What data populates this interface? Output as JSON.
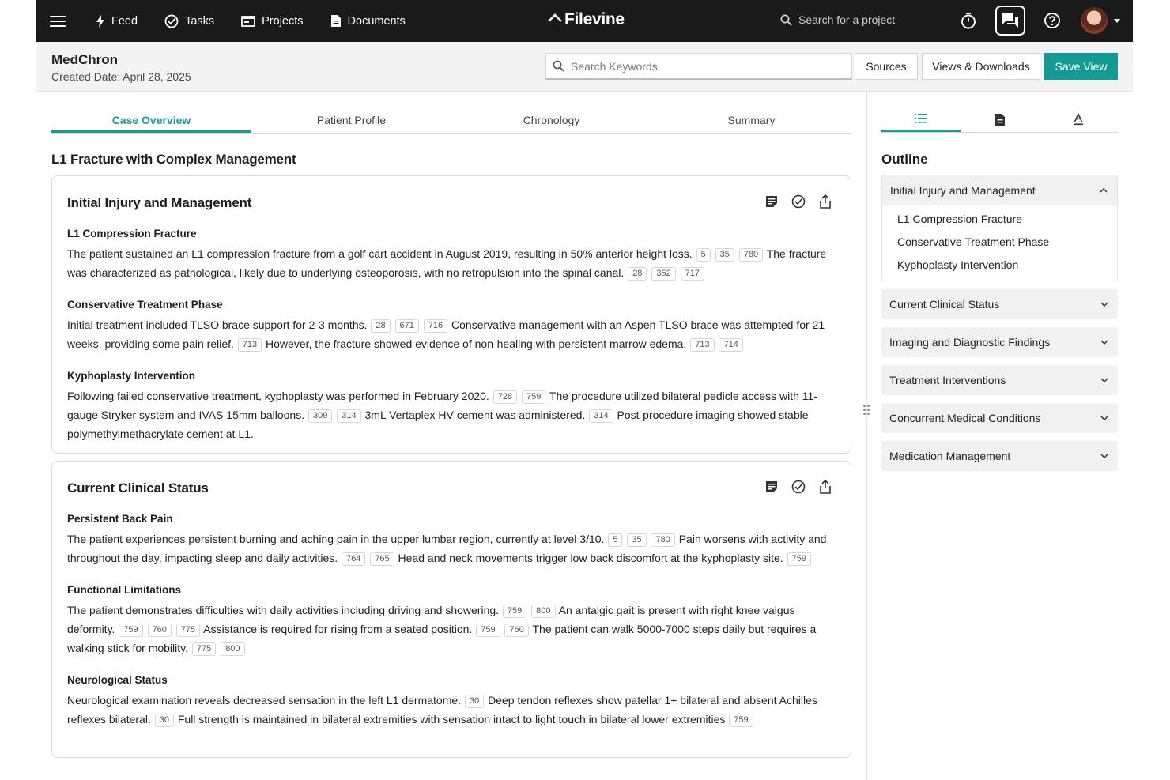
{
  "nav": {
    "items": [
      {
        "label": "Feed",
        "icon": "bolt-icon"
      },
      {
        "label": "Tasks",
        "icon": "check-circle-icon"
      },
      {
        "label": "Projects",
        "icon": "projects-icon"
      },
      {
        "label": "Documents",
        "icon": "document-icon"
      }
    ],
    "brand": "Filevine",
    "search_placeholder": "Search for a project"
  },
  "header": {
    "project_name": "MedChron",
    "created_date": "Created Date: April 28, 2025",
    "search_placeholder": "Search Keywords",
    "sources_label": "Sources",
    "views_label": "Views & Downloads",
    "save_label": "Save View"
  },
  "tabs": [
    "Case Overview",
    "Patient Profile",
    "Chronology",
    "Summary"
  ],
  "main_title": "L1 Fracture with Complex Management",
  "cards": [
    {
      "title": "Initial Injury and Management",
      "sections": [
        {
          "title": "L1 Compression Fracture",
          "parts": [
            {
              "t": "The patient sustained an L1 compression fracture from a golf cart accident in August 2019, resulting in 50% anterior height loss. "
            },
            {
              "r": [
                "5",
                "35",
                "780"
              ]
            },
            {
              "t": " The fracture was characterized as pathological, likely due to underlying osteoporosis, with no retropulsion into the spinal canal. "
            },
            {
              "r": [
                "28",
                "352",
                "717"
              ]
            }
          ]
        },
        {
          "title": "Conservative Treatment Phase",
          "parts": [
            {
              "t": "Initial treatment included TLSO brace support for 2-3 months. "
            },
            {
              "r": [
                "28",
                "671",
                "716"
              ]
            },
            {
              "t": " Conservative management with an Aspen TLSO brace was attempted for 21 weeks, providing some pain relief. "
            },
            {
              "r": [
                "713"
              ]
            },
            {
              "t": " However, the fracture showed evidence of non-healing with persistent marrow edema. "
            },
            {
              "r": [
                "713",
                "714"
              ]
            }
          ]
        },
        {
          "title": "Kyphoplasty Intervention",
          "parts": [
            {
              "t": "Following failed conservative treatment, kyphoplasty was performed in February 2020. "
            },
            {
              "r": [
                "728",
                "759"
              ]
            },
            {
              "t": " The procedure utilized bilateral pedicle access with 11-gauge Stryker system and IVAS 15mm balloons. "
            },
            {
              "r": [
                "309",
                "314"
              ]
            },
            {
              "t": " 3mL Vertaplex HV cement was administered. "
            },
            {
              "r": [
                "314"
              ]
            },
            {
              "t": " Post-procedure imaging showed stable polymethylmethacrylate cement at L1."
            }
          ]
        }
      ]
    },
    {
      "title": "Current Clinical Status",
      "sections": [
        {
          "title": "Persistent Back Pain",
          "parts": [
            {
              "t": "The patient experiences persistent burning and aching pain in the upper lumbar region, currently at level 3/10. "
            },
            {
              "r": [
                "5",
                "35",
                "780"
              ]
            },
            {
              "t": " Pain worsens with activity and throughout the day, impacting sleep and daily activities. "
            },
            {
              "r": [
                "764",
                "765"
              ]
            },
            {
              "t": " Head and neck movements trigger low back discomfort at the kyphoplasty site. "
            },
            {
              "r": [
                "759"
              ]
            }
          ]
        },
        {
          "title": "Functional Limitations",
          "parts": [
            {
              "t": "The patient demonstrates difficulties with daily activities including driving and showering. "
            },
            {
              "r": [
                "759",
                "800"
              ]
            },
            {
              "t": " An antalgic gait is present with right knee valgus deformity. "
            },
            {
              "r": [
                "759",
                "760",
                "775"
              ]
            },
            {
              "t": " Assistance is required for rising from a seated position. "
            },
            {
              "r": [
                "759",
                "760"
              ]
            },
            {
              "t": " The patient can walk 5000-7000 steps daily but requires a walking stick for mobility. "
            },
            {
              "r": [
                "775",
                "800"
              ]
            }
          ]
        },
        {
          "title": "Neurological Status",
          "parts": [
            {
              "t": "Neurological examination reveals decreased sensation in the left L1 dermatome. "
            },
            {
              "r": [
                "30"
              ]
            },
            {
              "t": " Deep tendon reflexes show patellar 1+ bilateral and absent Achilles reflexes bilateral. "
            },
            {
              "r": [
                "30"
              ]
            },
            {
              "t": " Full strength is maintained in bilateral extremities with sensation intact to light touch in bilateral lower extremities "
            },
            {
              "r": [
                "759"
              ]
            }
          ]
        }
      ]
    }
  ],
  "sidebar": {
    "title": "Outline",
    "open_section": {
      "label": "Initial Injury and Management",
      "items": [
        "L1 Compression Fracture",
        "Conservative Treatment Phase",
        "Kyphoplasty Intervention"
      ]
    },
    "sections": [
      "Current Clinical Status",
      "Imaging and Diagnostic Findings",
      "Treatment Interventions",
      "Concurrent Medical Conditions",
      "Medication Management"
    ]
  },
  "colors": {
    "accent": "#139a94",
    "nav_bg": "#1a1a1a"
  }
}
